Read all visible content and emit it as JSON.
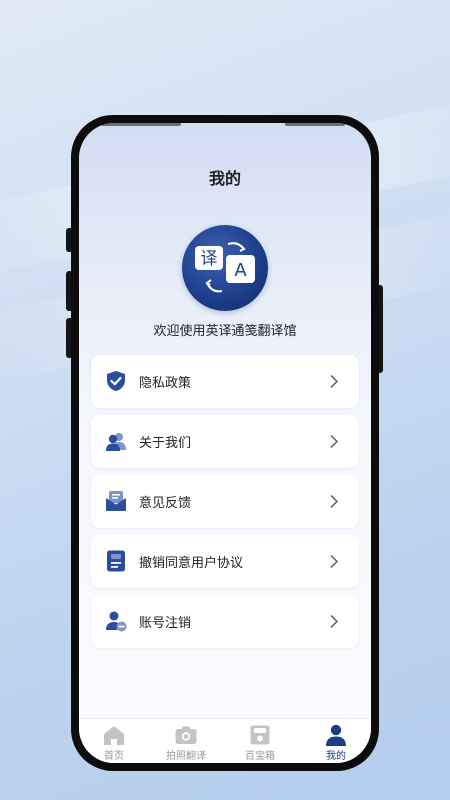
{
  "page": {
    "title": "我的",
    "welcome": "欢迎使用英译通笺翻译馆"
  },
  "logo": {
    "glyph_left": "译",
    "glyph_right": "A"
  },
  "menu": [
    {
      "label": "隐私政策",
      "icon": "shield-check-icon"
    },
    {
      "label": "关于我们",
      "icon": "users-icon"
    },
    {
      "label": "意见反馈",
      "icon": "feedback-mail-icon"
    },
    {
      "label": "撤销同意用户协议",
      "icon": "document-icon"
    },
    {
      "label": "账号注销",
      "icon": "user-remove-icon"
    }
  ],
  "tabs": [
    {
      "label": "首页",
      "icon": "home-icon",
      "active": false
    },
    {
      "label": "拍照翻译",
      "icon": "camera-icon",
      "active": false
    },
    {
      "label": "百宝箱",
      "icon": "toolbox-icon",
      "active": false
    },
    {
      "label": "我的",
      "icon": "profile-icon",
      "active": true
    }
  ],
  "colors": {
    "accent": "#1e3c86",
    "icon_fill": "#2b4d9c",
    "tab_inactive": "#bdbdbd"
  }
}
